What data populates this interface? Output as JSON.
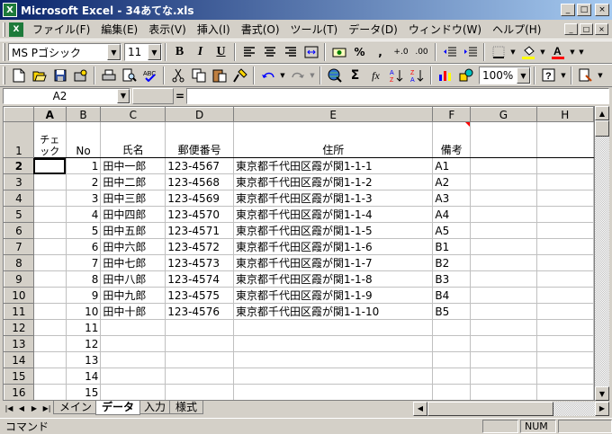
{
  "window": {
    "title": "Microsoft Excel - 34あてな.xls",
    "app_icon": "X",
    "minimize": "_",
    "maximize": "□",
    "close": "×"
  },
  "menu": {
    "items": [
      "ファイル(F)",
      "編集(E)",
      "表示(V)",
      "挿入(I)",
      "書式(O)",
      "ツール(T)",
      "データ(D)",
      "ウィンドウ(W)",
      "ヘルプ(H)"
    ]
  },
  "format_toolbar": {
    "font_name": "MS Pゴシック",
    "font_size": "11",
    "bold": "B",
    "italic": "I",
    "underline": "U",
    "percent": "%",
    "comma": ",",
    "inc_decimal": "+.0",
    "dec_decimal": ".00"
  },
  "std_toolbar": {
    "sum": "Σ",
    "fx": "fx",
    "zoom": "100%",
    "help": "?"
  },
  "formula_bar": {
    "name_box": "A2",
    "equals": "="
  },
  "sheet": {
    "columns": [
      "A",
      "B",
      "C",
      "D",
      "E",
      "F",
      "G",
      "H"
    ],
    "header_row": {
      "row": "1",
      "check": "チェック",
      "no": "No",
      "name": "氏名",
      "zip": "郵便番号",
      "address": "住所",
      "note": "備考"
    },
    "rows": [
      {
        "row": "2",
        "no": "1",
        "name": "田中一郎",
        "zip": "123-4567",
        "address": "東京都千代田区霞が関1-1-1",
        "note": "A1"
      },
      {
        "row": "3",
        "no": "2",
        "name": "田中二郎",
        "zip": "123-4568",
        "address": "東京都千代田区霞が関1-1-2",
        "note": "A2"
      },
      {
        "row": "4",
        "no": "3",
        "name": "田中三郎",
        "zip": "123-4569",
        "address": "東京都千代田区霞が関1-1-3",
        "note": "A3"
      },
      {
        "row": "5",
        "no": "4",
        "name": "田中四郎",
        "zip": "123-4570",
        "address": "東京都千代田区霞が関1-1-4",
        "note": "A4"
      },
      {
        "row": "6",
        "no": "5",
        "name": "田中五郎",
        "zip": "123-4571",
        "address": "東京都千代田区霞が関1-1-5",
        "note": "A5"
      },
      {
        "row": "7",
        "no": "6",
        "name": "田中六郎",
        "zip": "123-4572",
        "address": "東京都千代田区霞が関1-1-6",
        "note": "B1"
      },
      {
        "row": "8",
        "no": "7",
        "name": "田中七郎",
        "zip": "123-4573",
        "address": "東京都千代田区霞が関1-1-7",
        "note": "B2"
      },
      {
        "row": "9",
        "no": "8",
        "name": "田中八郎",
        "zip": "123-4574",
        "address": "東京都千代田区霞が関1-1-8",
        "note": "B3"
      },
      {
        "row": "10",
        "no": "9",
        "name": "田中九郎",
        "zip": "123-4575",
        "address": "東京都千代田区霞が関1-1-9",
        "note": "B4"
      },
      {
        "row": "11",
        "no": "10",
        "name": "田中十郎",
        "zip": "123-4576",
        "address": "東京都千代田区霞が関1-1-10",
        "note": "B5"
      },
      {
        "row": "12",
        "no": "11",
        "name": "",
        "zip": "",
        "address": "",
        "note": ""
      },
      {
        "row": "13",
        "no": "12",
        "name": "",
        "zip": "",
        "address": "",
        "note": ""
      },
      {
        "row": "14",
        "no": "13",
        "name": "",
        "zip": "",
        "address": "",
        "note": ""
      },
      {
        "row": "15",
        "no": "14",
        "name": "",
        "zip": "",
        "address": "",
        "note": ""
      },
      {
        "row": "16",
        "no": "15",
        "name": "",
        "zip": "",
        "address": "",
        "note": ""
      }
    ]
  },
  "tabs": [
    "メイン",
    "データ",
    "入力",
    "様式"
  ],
  "status": {
    "mode": "コマンド",
    "num": "NUM"
  }
}
